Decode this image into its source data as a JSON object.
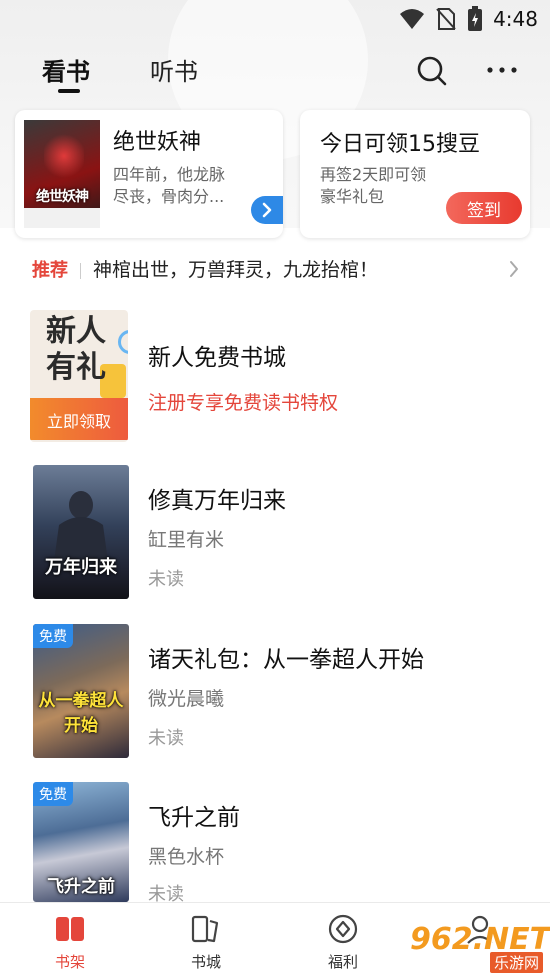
{
  "status_bar": {
    "time": "4:48"
  },
  "header": {
    "tabs": [
      {
        "label": "看书",
        "active": true
      },
      {
        "label": "听书",
        "active": false
      }
    ],
    "search_icon": "search-icon",
    "more_icon": "more-icon"
  },
  "featured_book": {
    "title": "绝世妖神",
    "cover_title": "绝世妖神",
    "desc_line1": "四年前，他龙脉",
    "desc_line2": "尽丧，骨肉分..."
  },
  "sign_card": {
    "title": "今日可领15搜豆",
    "desc_line1": "再签2天即可领",
    "desc_line2": "豪华礼包",
    "button": "签到"
  },
  "recommend": {
    "label": "推荐",
    "text": "神棺出世，万兽拜灵，九龙抬棺！"
  },
  "promo": {
    "cover_line1": "新人",
    "cover_line2": "有礼",
    "cover_button": "立即领取",
    "title": "新人免费书城",
    "subtitle": "注册专享免费读书特权"
  },
  "books": [
    {
      "title": "修真万年归来",
      "author": "缸里有米",
      "status": "未读",
      "cover_title": "万年归来",
      "free": false
    },
    {
      "title": "诸天礼包：从一拳超人开始",
      "author": "微光晨曦",
      "status": "未读",
      "cover_title": "从一拳超人开始",
      "free": true,
      "badge": "免费"
    },
    {
      "title": "飞升之前",
      "author": "黑色水杯",
      "status": "未读",
      "cover_title": "飞升之前",
      "free": true,
      "badge": "免费"
    }
  ],
  "bottom_nav": [
    {
      "label": "书架",
      "active": true
    },
    {
      "label": "书城",
      "active": false
    },
    {
      "label": "福利",
      "active": false
    }
  ],
  "watermark": {
    "big": "962.NET",
    "small": "乐游网"
  },
  "colors": {
    "accent": "#e4463b",
    "blue": "#2e89e6"
  }
}
